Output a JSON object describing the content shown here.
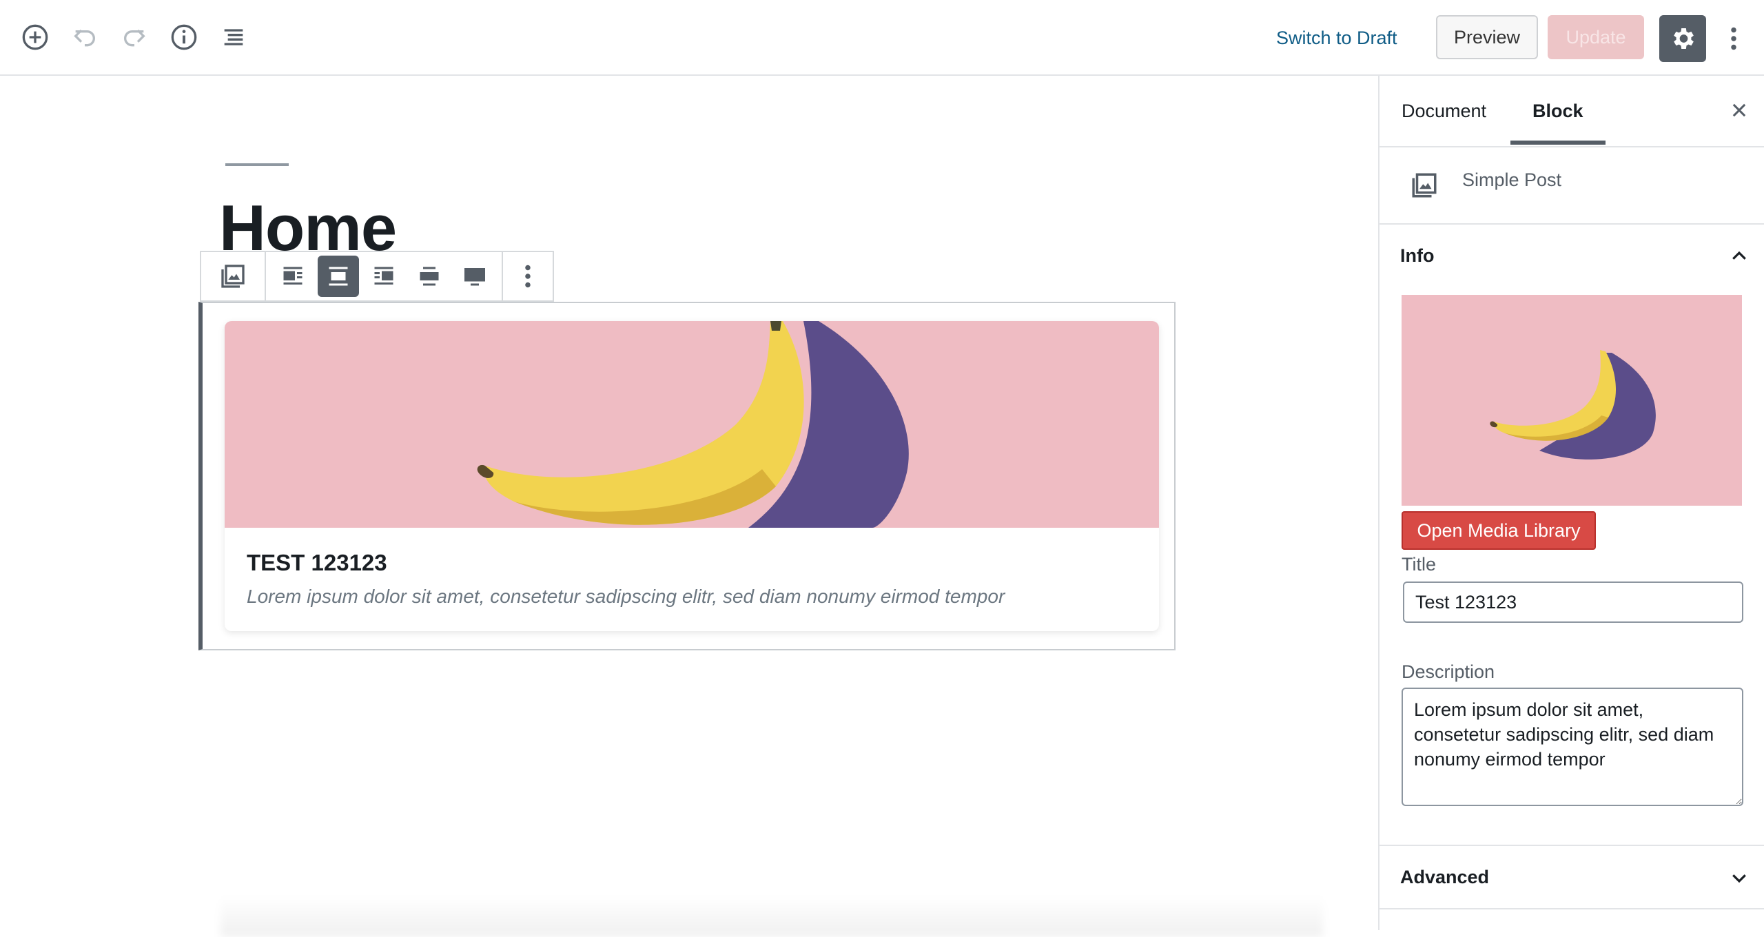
{
  "header": {
    "switch_to_draft": "Switch to Draft",
    "preview": "Preview",
    "update": "Update",
    "icons": [
      "add-block-icon",
      "undo-icon",
      "redo-icon",
      "info-icon",
      "outline-icon",
      "gear-icon",
      "more-vertical-icon"
    ]
  },
  "editor": {
    "post_title": "Home",
    "card": {
      "title": "TEST 123123",
      "description": "Lorem ipsum dolor sit amet, consetetur sadipscing elitr, sed diam nonumy eirmod tempor"
    },
    "toolbar_icons": [
      "block-type-icon",
      "align-left-icon",
      "align-center-icon",
      "align-right-icon",
      "wide-width-icon",
      "full-width-icon",
      "more-options-icon"
    ]
  },
  "sidebar": {
    "tabs": [
      "Document",
      "Block"
    ],
    "active_tab": "Block",
    "block_name": "Simple Post",
    "info_panel": {
      "title": "Info",
      "open_media_library": "Open Media Library",
      "title_label": "Title",
      "title_value": "Test 123123",
      "description_label": "Description",
      "description_value": "Lorem ipsum dolor sit amet, consetetur sadipscing elitr, sed diam nonumy eirmod tempor"
    },
    "advanced_panel": {
      "title": "Advanced"
    }
  },
  "colors": {
    "accent": "#0f5c86",
    "update_disabled": "#edc5c7",
    "media_button": "#d84a45",
    "image_background": "#efbcc3",
    "toolbar_active": "#555d66"
  }
}
